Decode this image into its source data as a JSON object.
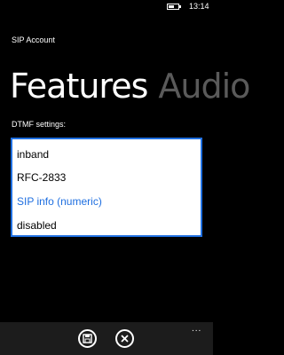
{
  "status_bar": {
    "time": "13:14",
    "battery_icon": "battery-icon"
  },
  "app": {
    "title": "SIP Account"
  },
  "pivot": {
    "tabs": [
      {
        "label": "Features",
        "active": true
      },
      {
        "label": "Audio",
        "active": false
      }
    ]
  },
  "dtmf": {
    "label": "DTMF settings:",
    "options": [
      "inband",
      "RFC-2833",
      "SIP info (numeric)",
      "disabled"
    ],
    "selected": "SIP info (numeric)"
  },
  "app_bar": {
    "buttons": [
      {
        "icon": "save-icon"
      },
      {
        "icon": "close-icon"
      }
    ],
    "more_label": "..."
  },
  "colors": {
    "accent": "#1f6fe0",
    "background": "#000000",
    "inactive_tab": "#5a5a5a",
    "app_bar": "#1c1c1c"
  }
}
